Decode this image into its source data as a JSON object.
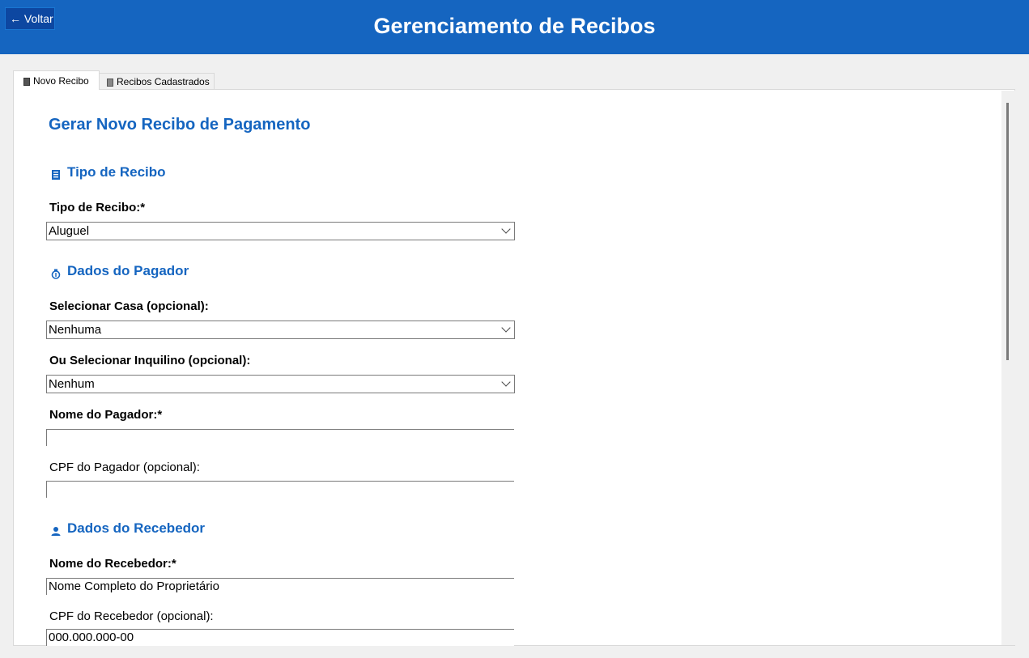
{
  "header": {
    "back_label": "← Voltar",
    "title": "Gerenciamento de Recibos"
  },
  "tabs": [
    {
      "label": "Novo Recibo",
      "icon": "receipt-icon",
      "active": true
    },
    {
      "label": "Recibos Cadastrados",
      "icon": "clipboard-icon",
      "active": false
    }
  ],
  "form": {
    "title": "Gerar Novo Recibo de Pagamento",
    "sections": {
      "tipo": {
        "title": "Tipo de Recibo",
        "icon": "receipt-icon",
        "tipo_label": "Tipo de Recibo:*",
        "tipo_value": "Aluguel"
      },
      "pagador": {
        "title": "Dados do Pagador",
        "icon": "money-bag-icon",
        "casa_label": "Selecionar Casa (opcional):",
        "casa_value": "Nenhuma",
        "inquilino_label": "Ou Selecionar Inquilino (opcional):",
        "inquilino_value": "Nenhum",
        "nome_label": "Nome do Pagador:*",
        "nome_value": "",
        "cpf_label": "CPF do Pagador (opcional):",
        "cpf_value": ""
      },
      "recebedor": {
        "title": "Dados do Recebedor",
        "icon": "person-icon",
        "nome_label": "Nome do Recebedor:*",
        "nome_value": "Nome Completo do Proprietário",
        "cpf_label": "CPF do Recebedor (opcional):",
        "cpf_value": "000.000.000-00"
      }
    }
  },
  "colors": {
    "header_bg": "#1565c0",
    "accent": "#1565c0",
    "back_button_bg": "#0d47a1"
  }
}
